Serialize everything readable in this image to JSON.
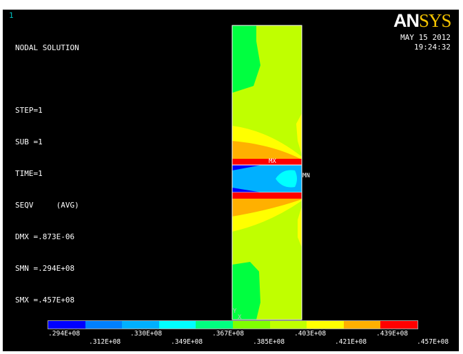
{
  "window_number": "1",
  "info_lines": [
    "NODAL SOLUTION",
    "",
    "STEP=1",
    "SUB =1",
    "TIME=1",
    "SEQV     (AVG)",
    "DMX =.873E-06",
    "SMN =.294E+08",
    "SMX =.457E+08"
  ],
  "logo": {
    "an": "AN",
    "sys": "SYS"
  },
  "date": "MAY 15 2012",
  "time": "19:24:32",
  "labels": {
    "mx": "MX",
    "mn": "MN",
    "y": "Y",
    "x": "X"
  },
  "legend": {
    "colors": [
      "#0000ff",
      "#0080ff",
      "#00b0ff",
      "#00ffff",
      "#00ff80",
      "#80ff00",
      "#c0ff00",
      "#ffff00",
      "#ffb000",
      "#ff0000"
    ],
    "top_ticks": [
      ".294E+08",
      ".330E+08",
      ".367E+08",
      ".403E+08",
      ".439E+08"
    ],
    "bottom_ticks": [
      ".312E+08",
      ".349E+08",
      ".385E+08",
      ".421E+08",
      ".457E+08"
    ]
  }
}
